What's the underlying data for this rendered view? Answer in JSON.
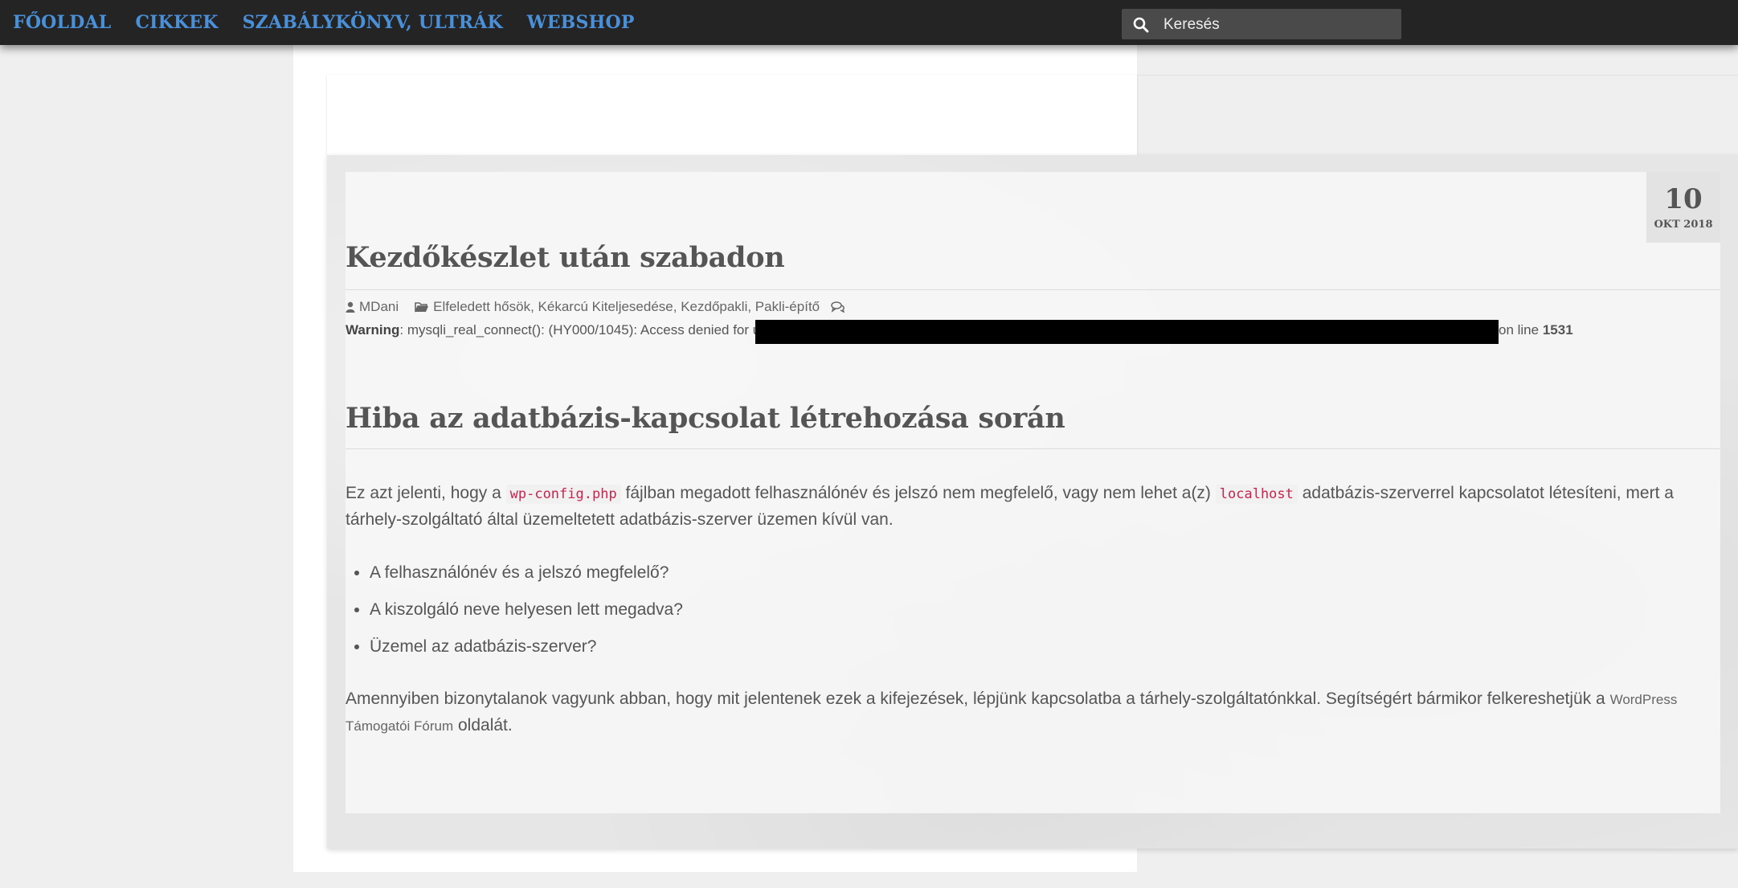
{
  "nav": {
    "items": [
      "FŐOLDAL",
      "CIKKEK",
      "SZABÁLYKÖNYV, ULTRÁK",
      "WEBSHOP"
    ],
    "search_placeholder": "Keresés"
  },
  "post": {
    "date_day": "10",
    "date_month": "OKT 2018",
    "title": "Kezdőkészlet után szabadon",
    "author": "MDani",
    "categories": "Elfeledett hősök, Kékarcú Kiteljesedése, Kezdőpakli, Pakli-építő"
  },
  "warning": {
    "label": "Warning",
    "text": ": mysqli_real_connect(): (HY000/1045): Access denied for user",
    "tail_text": "on line ",
    "line": "1531"
  },
  "error": {
    "heading": "Hiba az adatbázis-kapcsolat létrehozása során",
    "p1_a": "Ez azt jelenti, hogy a ",
    "p1_code1": "wp-config.php",
    "p1_b": " fájlban megadott felhasználónév és jelszó nem megfelelő, vagy nem lehet a(z) ",
    "p1_code2": "localhost",
    "p1_c": " adatbázis-szerverrel kapcsolatot létesíteni, mert a tárhely-szolgáltató által üzemeltetett adatbázis-szerver üzemen kívül van.",
    "checklist": [
      "A felhasználónév és a jelszó megfelelő?",
      "A kiszolgáló neve helyesen lett megadva?",
      "Üzemel az adatbázis-szerver?"
    ],
    "p2_a": "Amennyiben bizonytalanok vagyunk abban, hogy mit jelentenek ezek a kifejezések, lépjünk kapcsolatba a tárhely-szolgáltatónkkal. Segítségért bármikor felkereshetjük a ",
    "p2_link": "WordPress Támogatói Fórum",
    "p2_b": " oldalát."
  },
  "colors": {
    "nav_bg": "#242424",
    "nav_link": "#4a90d9",
    "code_text": "#c7254e"
  }
}
